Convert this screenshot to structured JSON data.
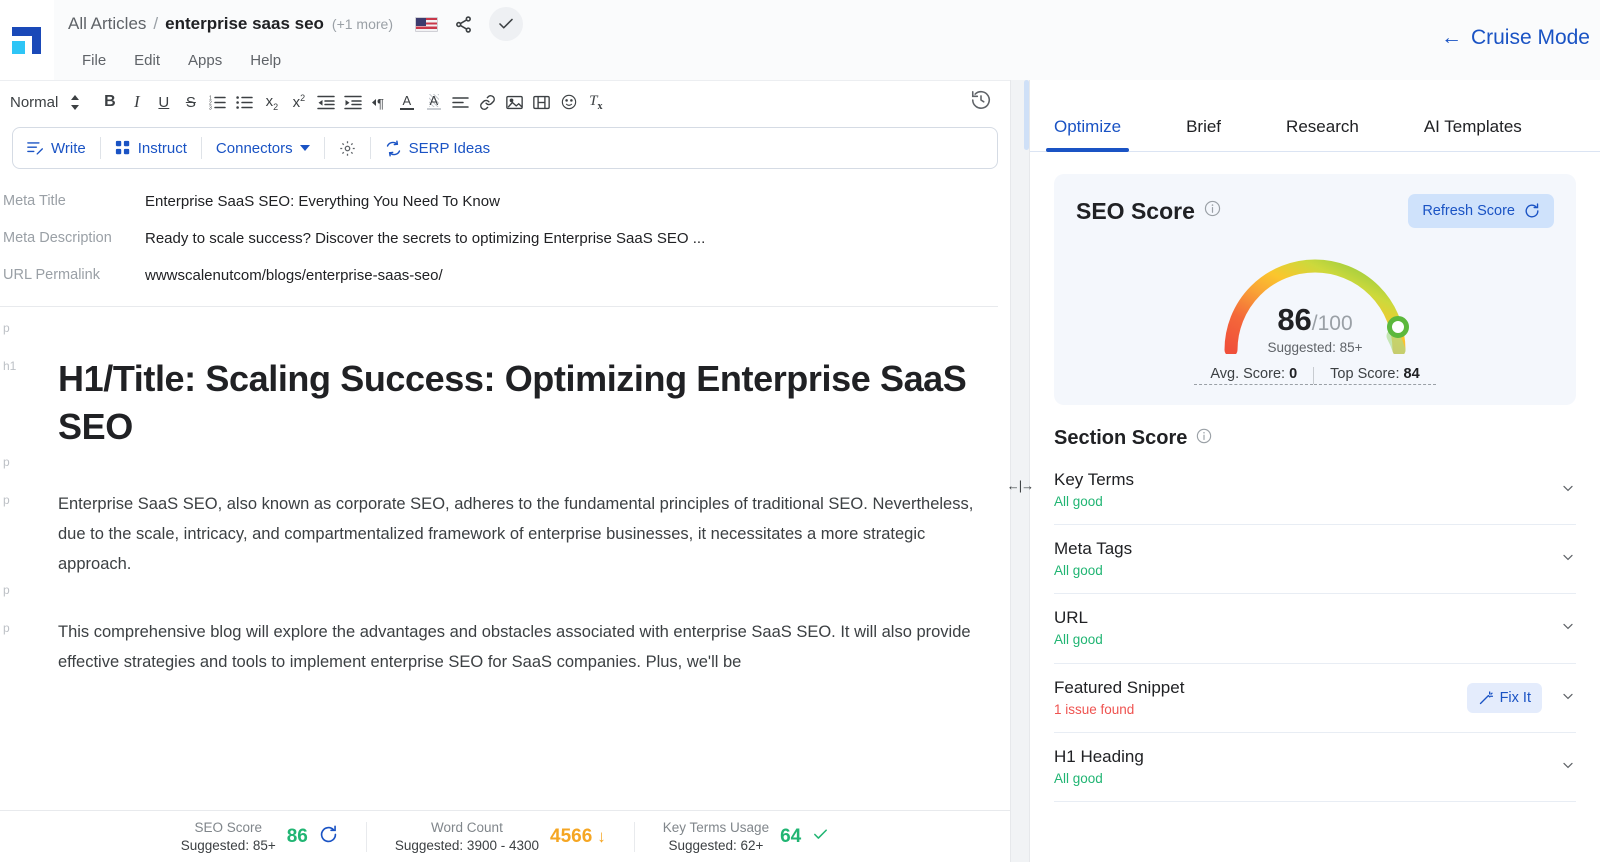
{
  "topbar": {
    "breadcrumb_root": "All Articles",
    "breadcrumb_sep": "/",
    "breadcrumb_current": "enterprise saas seo",
    "breadcrumb_more": "(+1 more)",
    "flag_icon": "us-flag-icon",
    "share_icon": "share-icon",
    "saved_icon": "check-icon",
    "cruise_label": "Cruise Mode",
    "cruise_arrow": "←",
    "menu": [
      "File",
      "Edit",
      "Apps",
      "Help"
    ]
  },
  "format_toolbar": {
    "style_label": "Normal",
    "style_stepper_icon": "up-down-arrows-icon",
    "history_icon": "history-revert-icon",
    "icons": [
      {
        "name": "bold-icon",
        "glyph": "B"
      },
      {
        "name": "italic-icon",
        "glyph": "I"
      },
      {
        "name": "underline-icon",
        "glyph": "U"
      },
      {
        "name": "strikethrough-icon",
        "glyph": "S"
      },
      {
        "name": "ordered-list-icon",
        "glyph": ""
      },
      {
        "name": "bullet-list-icon",
        "glyph": ""
      },
      {
        "name": "subscript-icon",
        "glyph": "x₂"
      },
      {
        "name": "superscript-icon",
        "glyph": "x²"
      },
      {
        "name": "outdent-icon",
        "glyph": ""
      },
      {
        "name": "indent-icon",
        "glyph": ""
      },
      {
        "name": "text-direction-icon",
        "glyph": "¶"
      },
      {
        "name": "text-color-icon",
        "glyph": "A"
      },
      {
        "name": "highlight-color-icon",
        "glyph": "A"
      },
      {
        "name": "align-icon",
        "glyph": ""
      },
      {
        "name": "link-icon",
        "glyph": ""
      },
      {
        "name": "image-icon",
        "glyph": ""
      },
      {
        "name": "video-icon",
        "glyph": ""
      },
      {
        "name": "emoji-icon",
        "glyph": ""
      },
      {
        "name": "clear-formatting-icon",
        "glyph": "Tx"
      }
    ]
  },
  "ai_toolbar": {
    "write": "Write",
    "instruct": "Instruct",
    "connectors": "Connectors",
    "settings_icon": "gear-icon",
    "serp_ideas": "SERP Ideas"
  },
  "meta": [
    {
      "label": "Meta Title",
      "value": "Enterprise SaaS SEO: Everything You Need To Know"
    },
    {
      "label": "Meta Description",
      "value": "Ready to scale success? Discover the secrets to optimizing Enterprise SaaS SEO ..."
    },
    {
      "label": "URL Permalink",
      "value": "wwwscalenutcom/blogs/enterprise-saas-seo/"
    }
  ],
  "document": {
    "blocks": [
      {
        "tag": "p",
        "type": "empty",
        "text": ""
      },
      {
        "tag": "h1",
        "type": "h1",
        "text": "H1/Title: Scaling Success: Optimizing Enterprise SaaS SEO"
      },
      {
        "tag": "p",
        "type": "empty",
        "text": ""
      },
      {
        "tag": "p",
        "type": "para",
        "text": "Enterprise SaaS SEO, also known as corporate SEO, adheres to the fundamental principles of traditional SEO. Nevertheless, due to the scale, intricacy, and compartmentalized framework of enterprise businesses, it necessitates a more strategic approach."
      },
      {
        "tag": "p",
        "type": "empty",
        "text": ""
      },
      {
        "tag": "p",
        "type": "para",
        "text": "This comprehensive blog will explore the advantages and obstacles associated with enterprise SaaS SEO. It will also provide effective strategies and tools to implement enterprise SEO for SaaS companies. Plus, we'll be"
      }
    ]
  },
  "statusbar": {
    "items": [
      {
        "name": "SEO Score",
        "suggested": "Suggested: 85+",
        "value": "86",
        "value_color": "#21b573",
        "trailing_icon": "refresh-icon"
      },
      {
        "name": "Word Count",
        "suggested": "Suggested: 3900 - 4300",
        "value": "4566",
        "value_color": "#f5a623",
        "trailing_icon": "down-arrow-icon"
      },
      {
        "name": "Key Terms Usage",
        "suggested": "Suggested: 62+",
        "value": "64",
        "value_color": "#21b573",
        "trailing_icon": "check-icon"
      }
    ]
  },
  "right_panel": {
    "tabs": [
      {
        "label": "Optimize",
        "active": true
      },
      {
        "label": "Brief",
        "active": false
      },
      {
        "label": "Research",
        "active": false
      },
      {
        "label": "AI Templates",
        "active": false
      }
    ],
    "seo_score": {
      "title": "SEO Score",
      "info_icon": "info-icon",
      "refresh_label": "Refresh Score",
      "refresh_icon": "refresh-icon",
      "score": "86",
      "denominator": "/100",
      "suggested": "Suggested: 85+",
      "avg_label": "Avg. Score:",
      "avg_value": "0",
      "top_label": "Top Score:",
      "top_value": "84",
      "gauge_percent": 86,
      "gauge_colors": [
        "#f0503a",
        "#f58a33",
        "#fbc02d",
        "#c4d93b",
        "#7cc442",
        "#4caf50"
      ]
    },
    "section_score": {
      "title": "Section Score",
      "info_icon": "info-icon",
      "rows": [
        {
          "name": "Key Terms",
          "status": "All good",
          "state": "good",
          "action": null
        },
        {
          "name": "Meta Tags",
          "status": "All good",
          "state": "good",
          "action": null
        },
        {
          "name": "URL",
          "status": "All good",
          "state": "good",
          "action": null
        },
        {
          "name": "Featured Snippet",
          "status": "1 issue found",
          "state": "issue",
          "action": "Fix It"
        },
        {
          "name": "H1 Heading",
          "status": "All good",
          "state": "good",
          "action": null
        }
      ]
    }
  },
  "resize_handle": "←|→"
}
